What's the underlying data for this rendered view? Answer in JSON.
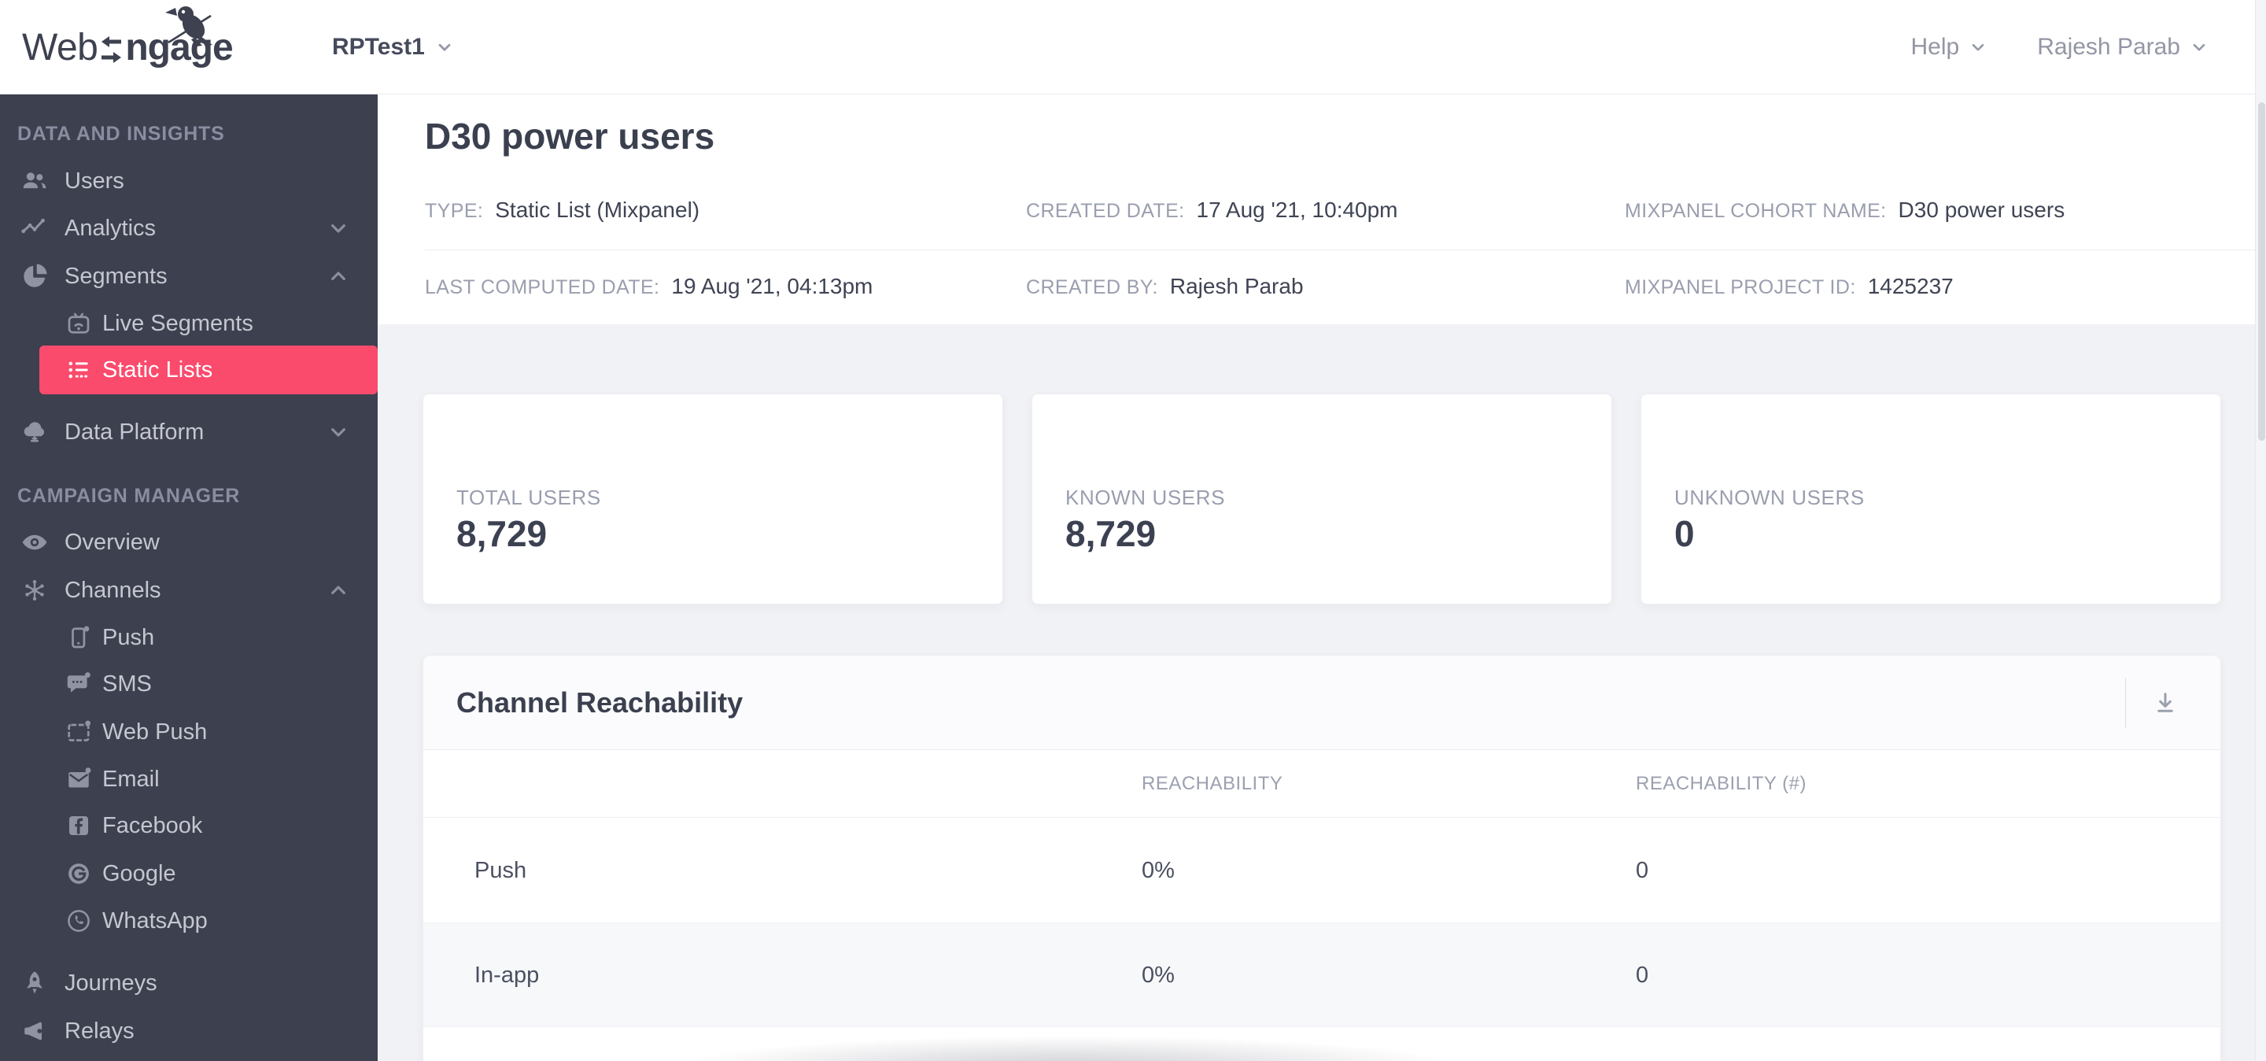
{
  "topbar": {
    "logo_web": "Web",
    "logo_ngage": "ngage",
    "project": "RPTest1",
    "help": "Help",
    "user": "Rajesh Parab"
  },
  "sidebar": {
    "section_data_insights": "DATA AND INSIGHTS",
    "section_campaign_manager": "CAMPAIGN MANAGER",
    "active_item": "Static Lists",
    "items": {
      "users": "Users",
      "analytics": "Analytics",
      "segments": "Segments",
      "live_segments": "Live Segments",
      "static_lists": "Static Lists",
      "data_platform": "Data Platform",
      "overview": "Overview",
      "channels": "Channels",
      "push": "Push",
      "sms": "SMS",
      "web_push": "Web Push",
      "email": "Email",
      "facebook": "Facebook",
      "google": "Google",
      "whatsapp": "WhatsApp",
      "journeys": "Journeys",
      "relays": "Relays"
    }
  },
  "page": {
    "title": "D30 power users",
    "meta": {
      "type_label": "TYPE:",
      "type_value": "Static List (Mixpanel)",
      "created_date_label": "CREATED DATE:",
      "created_date_value": "17 Aug '21, 10:40pm",
      "cohort_label": "MIXPANEL COHORT NAME:",
      "cohort_value": "D30 power users",
      "computed_label": "LAST COMPUTED DATE:",
      "computed_value": "19 Aug '21, 04:13pm",
      "created_by_label": "CREATED BY:",
      "created_by_value": "Rajesh Parab",
      "project_id_label": "MIXPANEL PROJECT ID:",
      "project_id_value": "1425237"
    },
    "stats": {
      "total_label": "TOTAL USERS",
      "total_value": "8,729",
      "known_label": "KNOWN USERS",
      "known_value": "8,729",
      "unknown_label": "UNKNOWN USERS",
      "unknown_value": "0"
    }
  },
  "reachability": {
    "title": "Channel Reachability",
    "col_reachability": "REACHABILITY",
    "col_reachability_num": "REACHABILITY (#)",
    "rows": [
      {
        "channel": "Push",
        "pct": "0%",
        "num": "0"
      },
      {
        "channel": "In-app",
        "pct": "0%",
        "num": "0"
      }
    ]
  },
  "icons": {
    "logo_bird": "bird",
    "logo_arrows": "left-right-arrows",
    "users": "two-people",
    "analytics": "trend-line",
    "segments": "pie-chart",
    "live_segments": "tv-wifi",
    "static_lists": "dotted-list",
    "data_platform": "cloud",
    "overview": "eye",
    "channels": "hub",
    "push": "smartphone-dot",
    "sms": "chat-bubble-dot",
    "web_push": "browser-dot",
    "email": "envelope-dot",
    "facebook": "facebook-f",
    "google": "google-g",
    "whatsapp": "whatsapp-phone",
    "journeys": "rocket",
    "relays": "megaphone",
    "chevron_down": "chevron-down",
    "chevron_up": "chevron-up",
    "download": "download-arrow"
  },
  "colors": {
    "accent_pink": "#fa4b6d",
    "sidebar_bg": "#3d404f",
    "body_bg": "#f1f2f5",
    "dark": "#3b4050",
    "muted": "#9a9eae",
    "line": "#e9ebf0"
  }
}
